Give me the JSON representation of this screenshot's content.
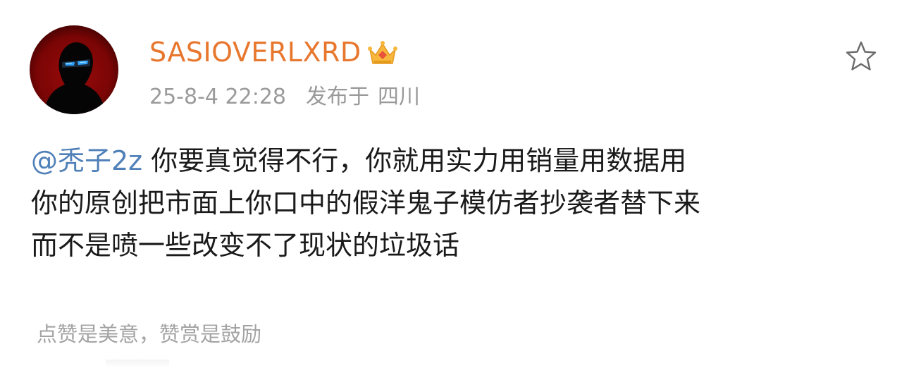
{
  "post": {
    "username": "SASIOVERLXRD",
    "badge_icon": "crown-icon",
    "timestamp": "25-8-4 22:28",
    "location_label": "发布于",
    "location": "四川",
    "favorite_icon": "star-outline-icon",
    "mention": "@秃子2z",
    "content_lines": [
      "你要真觉得不行，你就用实力用销量用数据用",
      "你的原创把市面上你口中的假洋鬼子模仿者抄袭者替下来",
      "而不是喷一些改变不了现状的垃圾话"
    ],
    "reward_note": "点赞是美意，赞赏是鼓励"
  },
  "colors": {
    "username": "#e8772e",
    "mention": "#4f80b8",
    "meta": "#9a9a9a",
    "text": "#1a1a1a"
  }
}
